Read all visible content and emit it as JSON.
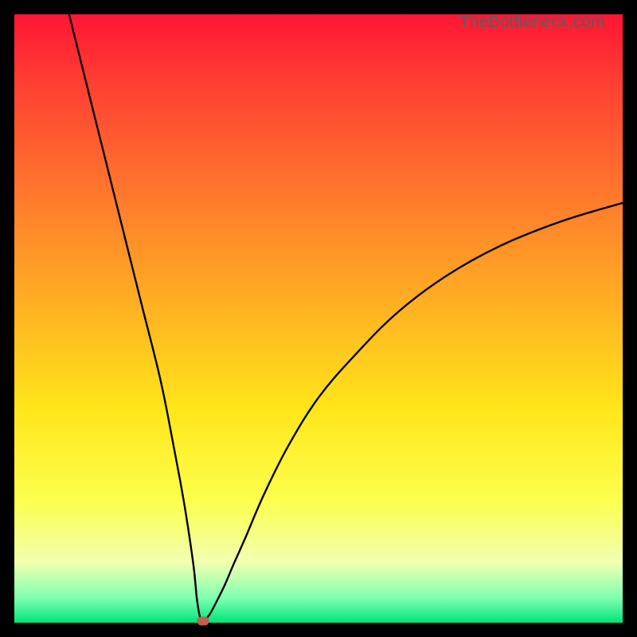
{
  "watermark": "TheBottleneck.com",
  "chart_data": {
    "type": "line",
    "title": "",
    "xlabel": "",
    "ylabel": "",
    "xlim": [
      0,
      100
    ],
    "ylim": [
      0,
      100
    ],
    "series": [
      {
        "name": "bottleneck-curve",
        "x": [
          9,
          12,
          15,
          18,
          21,
          24,
          26,
          27.5,
          28.5,
          29.5,
          30,
          30.5,
          31,
          32,
          33,
          34.5,
          36,
          38,
          41,
          45,
          50,
          56,
          63,
          71,
          80,
          90,
          100
        ],
        "y": [
          100,
          88,
          76,
          64,
          52,
          40,
          30,
          22,
          16,
          9,
          4,
          1,
          0.3,
          1.2,
          3,
          6,
          9.5,
          14,
          21,
          29,
          37,
          44,
          51,
          57,
          62,
          66,
          69
        ]
      }
    ],
    "marker": {
      "x": 31,
      "y": 0.3
    },
    "gradient_stops": [
      {
        "pos": 0,
        "color": "#ff1535"
      },
      {
        "pos": 25,
        "color": "#ff6a2f"
      },
      {
        "pos": 65,
        "color": "#ffe61a"
      },
      {
        "pos": 96,
        "color": "#7dffb0"
      },
      {
        "pos": 100,
        "color": "#00e57b"
      }
    ]
  }
}
